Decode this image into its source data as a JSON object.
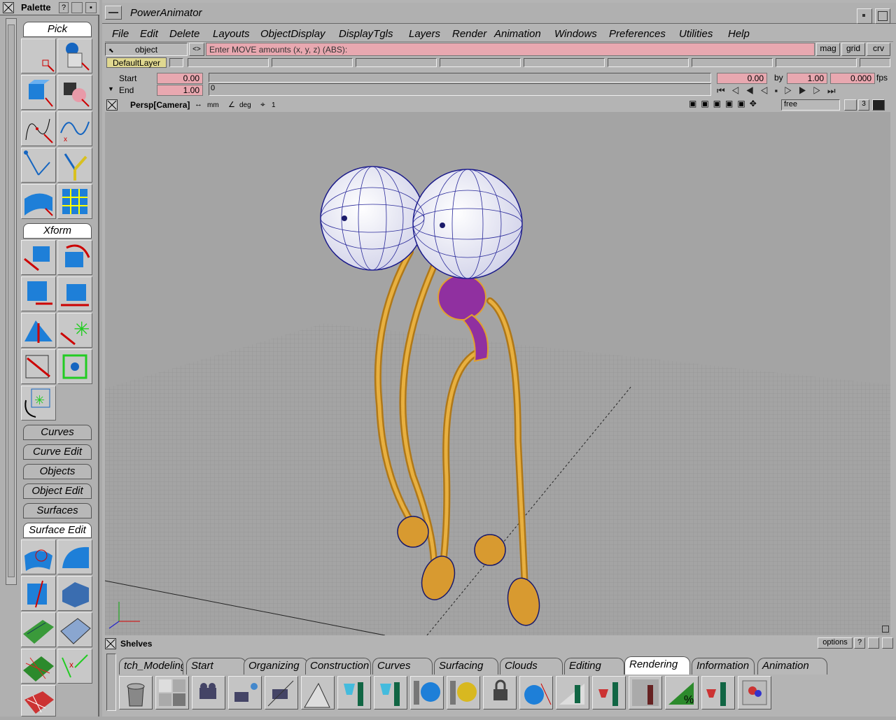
{
  "palette": {
    "title": "Palette",
    "help": "?",
    "tabs": {
      "pick": "Pick",
      "xform": "Xform",
      "curves": "Curves",
      "curve_edit": "Curve Edit",
      "objects": "Objects",
      "object_edit": "Object Edit",
      "surfaces": "Surfaces",
      "surface_edit": "Surface Edit"
    }
  },
  "window": {
    "title": "PowerAnimator"
  },
  "menu": [
    "File",
    "Edit",
    "Delete",
    "Layouts",
    "ObjectDisplay",
    "DisplayTgls",
    "Layers",
    "Render",
    "Animation",
    "Windows",
    "Preferences",
    "Utilities",
    "Help"
  ],
  "prompt": {
    "mode": "object",
    "arrows": "<>",
    "text": "Enter MOVE amounts (x, y, z) (ABS):",
    "buttons": [
      "mag",
      "grid",
      "crv"
    ]
  },
  "layers": {
    "default": "DefaultLayer"
  },
  "time": {
    "start_label": "Start",
    "start": "0.00",
    "end_label": "End",
    "end": "1.00",
    "current_frame": "0",
    "cur": "0.00",
    "by_label": "by",
    "by": "1.00",
    "fps_value": "0.000",
    "fps_label": "fps"
  },
  "view": {
    "name": "Persp[Camera]",
    "units_linear": "mm",
    "units_angle": "deg",
    "grid": "1",
    "mode": "free",
    "count": "3"
  },
  "shelves": {
    "title": "Shelves",
    "options": "options",
    "help": "?",
    "tabs": [
      "tch_Modeling",
      "Start",
      "Organizing",
      "Construction",
      "Curves",
      "Surfacing",
      "Clouds",
      "Editing",
      "Rendering",
      "Information",
      "Animation"
    ],
    "active": "Rendering"
  },
  "colors": {
    "accent_pink": "#e8a8b0",
    "layer_yellow": "#e0d890",
    "viewport": "#9a9a9a"
  }
}
